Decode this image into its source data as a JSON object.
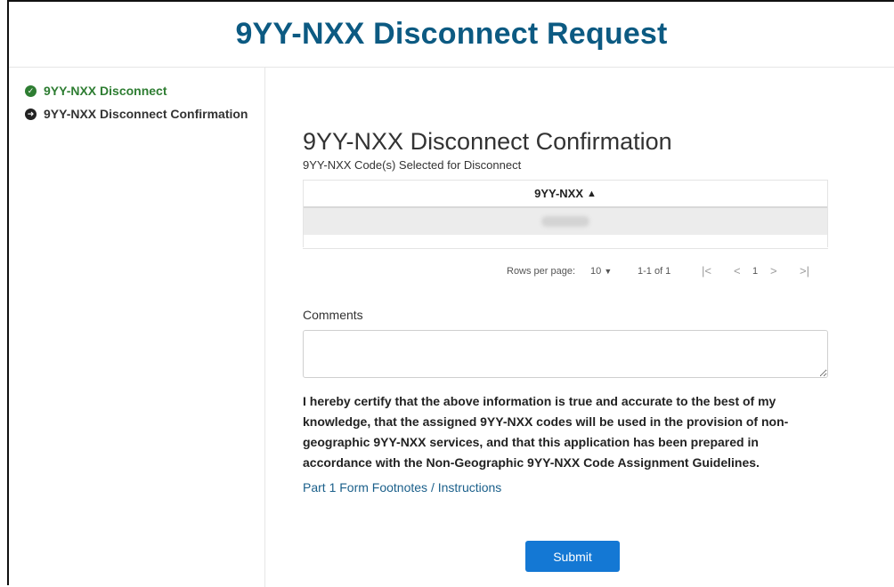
{
  "header": {
    "title": "9YY-NXX Disconnect Request"
  },
  "sidebar": {
    "steps": [
      {
        "label": "9YY-NXX Disconnect",
        "status": "done",
        "icon": "check-circle-icon"
      },
      {
        "label": "9YY-NXX Disconnect Confirmation",
        "status": "current",
        "icon": "arrow-circle-right-icon"
      }
    ]
  },
  "main": {
    "heading": "9YY-NXX Disconnect Confirmation",
    "grid": {
      "label": "9YY-NXX Code(s) Selected for Disconnect",
      "column_header": "9YY-NXX",
      "sort_indicator": "▲",
      "rows": [
        {
          "value": ""
        }
      ]
    },
    "pagination": {
      "rows_per_page_label": "Rows per page:",
      "rows_per_page_value": "10",
      "range": "1-1 of 1",
      "current_page": "1",
      "first": "|<",
      "prev": "<",
      "next": ">",
      "last": ">|"
    },
    "comments": {
      "label": "Comments",
      "value": ""
    },
    "certification": "I hereby certify that the above information is true and accurate to the best of my knowledge, that the assigned 9YY-NXX codes will be used in the provision of non-geographic 9YY-NXX services, and that this application has been prepared in accordance with the Non-Geographic 9YY-NXX Code Assignment Guidelines.",
    "footnotes_link": "Part 1 Form Footnotes / Instructions",
    "submit_label": "Submit"
  },
  "colors": {
    "title": "#0c5a82",
    "done": "#2e7d32",
    "link": "#1a5f8a",
    "primary_button": "#1478d4"
  }
}
